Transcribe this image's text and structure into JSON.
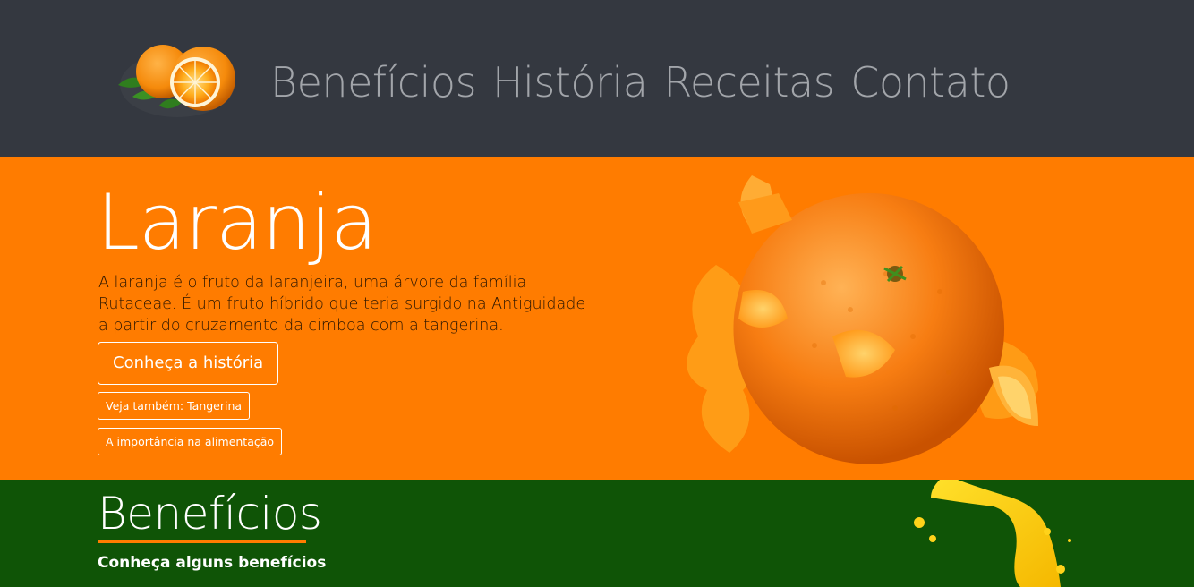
{
  "header": {
    "nav": [
      "Benefícios",
      "História",
      "Receitas",
      "Contato"
    ]
  },
  "hero": {
    "title": "Laranja",
    "description": "A laranja é o fruto da laranjeira, uma árvore da família Rutaceae. É um fruto híbrido que teria surgido na Antiguidade a partir do cruzamento da cimboa com a tangerina.",
    "primary_button": "Conheça a história",
    "secondary_buttons": [
      "Veja também: Tangerina",
      "A importância na alimentação"
    ]
  },
  "benefits": {
    "title": "Benefícios",
    "subtitle": "Conheça alguns benefícios"
  },
  "colors": {
    "header_bg": "#343840",
    "hero_bg": "#ff7c00",
    "benefits_bg": "#0f5406",
    "accent": "#ff7c00"
  },
  "icons": [
    "orange-logo-icon",
    "orange-splash-image",
    "juice-splash-image"
  ]
}
